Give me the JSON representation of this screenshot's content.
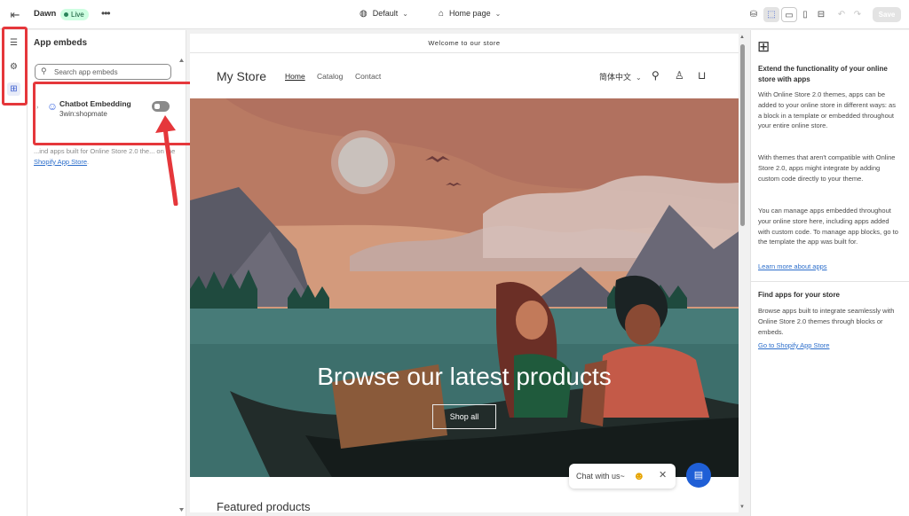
{
  "topbar": {
    "theme_name": "Dawn",
    "status_badge": "Live",
    "more_label": "•••",
    "template_select": "Default",
    "page_select": "Home page",
    "save_label": "Save"
  },
  "left_panel": {
    "title": "App embeds",
    "search_placeholder": "Search app embeds",
    "embed": {
      "name": "Chatbot Embedding",
      "app": "3win:shopmate",
      "enabled": false
    },
    "note_text": "...ind apps built for Online Store 2.0 the... on the",
    "note_link": "Shopify App Store",
    "note_end": "."
  },
  "store": {
    "announcement": "Welcome to our store",
    "logo": "My Store",
    "nav": [
      "Home",
      "Catalog",
      "Contact"
    ],
    "language": "简体中文",
    "hero_title": "Browse our latest products",
    "hero_button": "Shop all",
    "featured_heading": "Featured products"
  },
  "chat_widget": {
    "text": "Chat with us~"
  },
  "right_panel": {
    "heading1": "Extend the functionality of your online store with apps",
    "para1": "With Online Store 2.0 themes, apps can be added to your online store in different ways: as a block in a template or embedded throughout your entire online store.",
    "para2": "With themes that aren't compatible with Online Store 2.0, apps might integrate by adding custom code directly to your theme.",
    "para3": "You can manage apps embedded throughout your online store here, including apps added with custom code. To manage app blocks, go to the template the app was built for.",
    "link1": "Learn more about apps",
    "heading2": "Find apps for your store",
    "para4": "Browse apps built to integrate seamlessly with Online Store 2.0 themes through blocks or embeds.",
    "link2": "Go to Shopify App Store"
  },
  "colors": {
    "highlight": "#e5373b",
    "link": "#2c6ecb",
    "live_badge_bg": "#cdfee1"
  }
}
